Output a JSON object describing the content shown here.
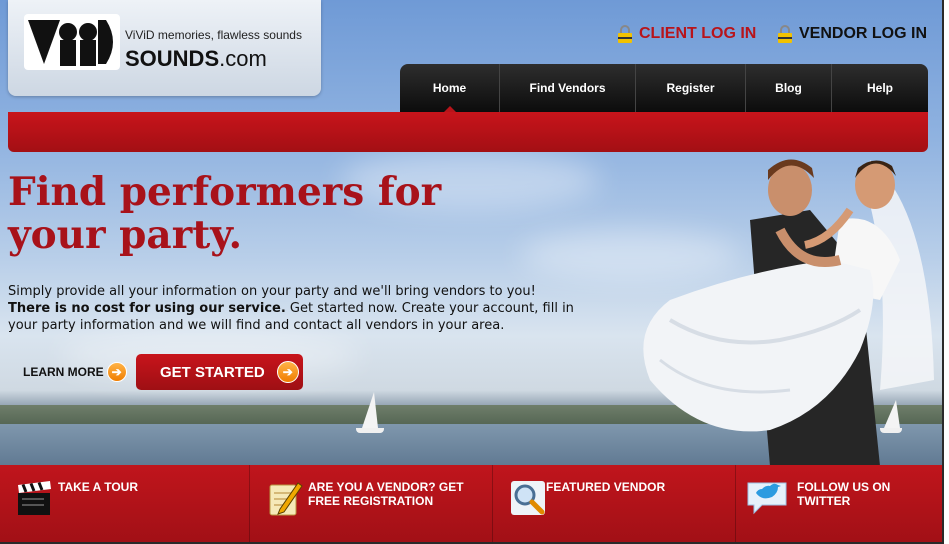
{
  "logo": {
    "mark_text": "ViD",
    "tagline": "ViViD memories, flawless sounds",
    "brand_bold": "SOUNDS",
    "brand_suffix": ".com"
  },
  "header": {
    "client_login": "CLIENT LOG IN",
    "vendor_login": "VENDOR LOG IN"
  },
  "nav": {
    "items": [
      {
        "label": "Home",
        "active": true
      },
      {
        "label": "Find Vendors",
        "active": false
      },
      {
        "label": "Register",
        "active": false
      },
      {
        "label": "Blog",
        "active": false
      },
      {
        "label": "Help",
        "active": false
      }
    ]
  },
  "hero": {
    "title": "Find performers for your party.",
    "text_line1": "Simply provide all your information on your party and we'll bring vendors to you!",
    "text_bold": "There is no cost for using our service.",
    "text_line2": " Get started now. Create your account, fill in your party information and we will find and contact all vendors in your area.",
    "learn_more": "LEARN MORE",
    "get_started": "GET STARTED"
  },
  "footer": {
    "items": [
      {
        "label": "TAKE A TOUR",
        "icon": "clapperboard-icon"
      },
      {
        "label": "ARE YOU A VENDOR? GET FREE REGISTRATION",
        "icon": "pencil-paper-icon"
      },
      {
        "label": "FEATURED VENDOR",
        "icon": "magnifier-icon"
      },
      {
        "label": "FOLLOW US ON TWITTER",
        "icon": "twitter-bird-icon"
      }
    ]
  },
  "colors": {
    "brand_red": "#b8141a",
    "nav_black": "#111111",
    "accent_orange": "#f07d00"
  }
}
